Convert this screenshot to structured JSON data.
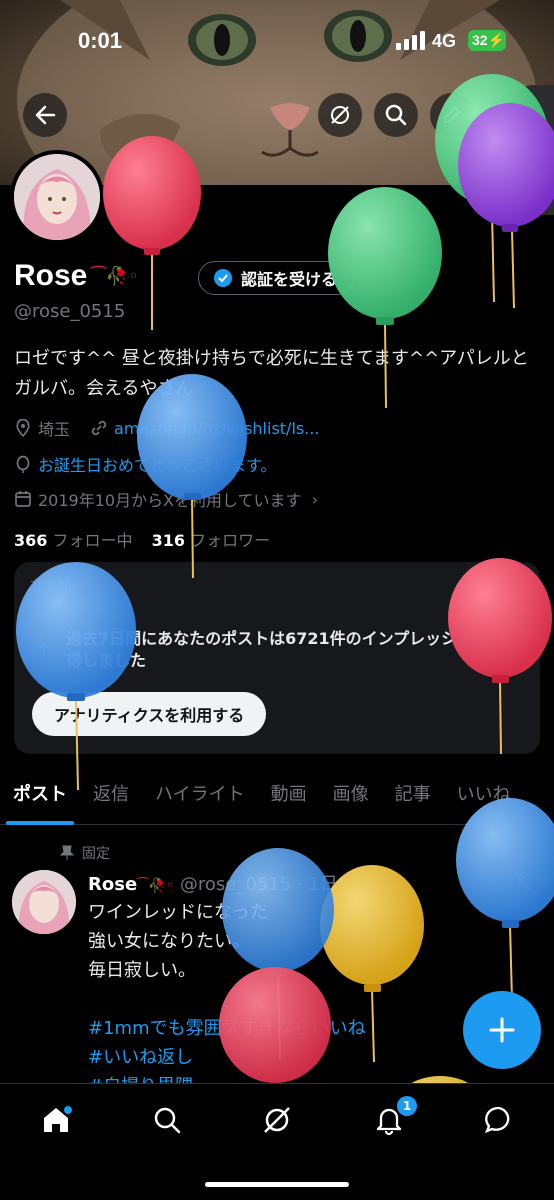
{
  "status_bar": {
    "time": "0:01",
    "network": "4G",
    "battery": "32"
  },
  "profile": {
    "name": "Rose",
    "name_decoration": "⁀🥀◦",
    "verify_label": "認証を受ける",
    "handle": "@rose_0515",
    "bio": "ロゼです^^ 昼と夜掛け持ちで必死に生きてます^^アパレルとガルバ。会えるやさん",
    "location": "埼玉",
    "link": "amazon.jp/hz/wishlist/ls...",
    "birthday": "お誕生日おめでとうございます。",
    "joined": "2019年10月からXを利用しています",
    "following_count": "366",
    "following_label": "フォロー中",
    "followers_count": "316",
    "followers_label": "フォロワー"
  },
  "analytics_card": {
    "label": "非公開",
    "message": "過去7日間にあなたのポストは6721件のインプレッションを獲得しました",
    "button": "アナリティクスを利用する"
  },
  "tabs": [
    "ポスト",
    "返信",
    "ハイライト",
    "動画",
    "画像",
    "記事",
    "いいね"
  ],
  "post": {
    "pinned_label": "固定",
    "author": "Rose",
    "author_decoration": "⁀🥀◦",
    "handle_time": "@rose_0515 · 1日",
    "lines": [
      "ワインレッドになった",
      "強い女になりたい。",
      "毎日寂しい。"
    ],
    "hashtags": [
      "#1mmでも雰囲気すきならいいね",
      "#いいね返し",
      "#自撮り界隈"
    ]
  },
  "bottom_nav": {
    "notifications_badge": "1"
  },
  "icons": [
    "back-arrow-icon",
    "grok-icon",
    "search-icon",
    "edit-icon",
    "verified-icon",
    "location-icon",
    "link-icon",
    "birthday-icon",
    "calendar-icon",
    "close-icon",
    "pin-icon",
    "x-logo-icon",
    "plus-icon",
    "home-icon",
    "notifications-icon",
    "messages-icon"
  ],
  "colors": {
    "accent": "#1d9bf0",
    "background": "#000000",
    "secondary_text": "#71767b"
  }
}
